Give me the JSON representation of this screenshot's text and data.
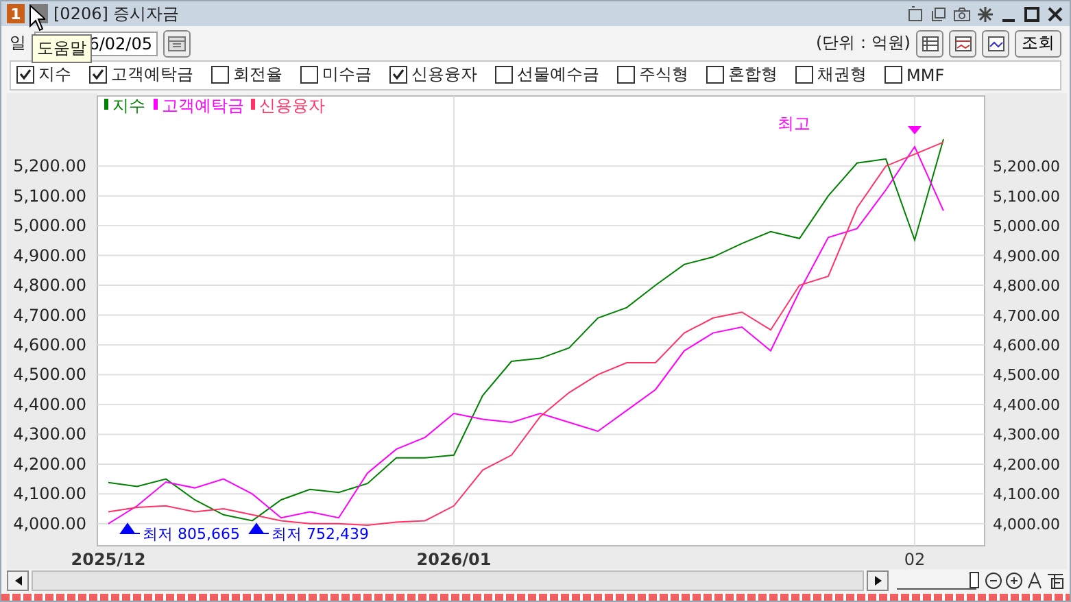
{
  "window": {
    "badge": "1",
    "title": "[0206] 증시자금"
  },
  "tooltip": {
    "text": "도움말"
  },
  "toolbar": {
    "date_label": "일",
    "date_value": "6/02/05",
    "unit": "(단위 : 억원)",
    "query_button": "조회"
  },
  "checkboxes": [
    {
      "label": "지수",
      "checked": true
    },
    {
      "label": "고객예탁금",
      "checked": true
    },
    {
      "label": "회전율",
      "checked": false
    },
    {
      "label": "미수금",
      "checked": false
    },
    {
      "label": "신용융자",
      "checked": true
    },
    {
      "label": "선물예수금",
      "checked": false
    },
    {
      "label": "주식형",
      "checked": false
    },
    {
      "label": "혼합형",
      "checked": false
    },
    {
      "label": "채권형",
      "checked": false
    },
    {
      "label": "MMF",
      "checked": false
    }
  ],
  "chart": {
    "markers": [
      {
        "kind": "low",
        "color": "#0000ff"
      },
      {
        "kind": "low",
        "color": "#0000ff"
      },
      {
        "kind": "high",
        "color": "#ff00ff"
      }
    ],
    "chart_data": {
      "type": "line",
      "grid": true,
      "legend": true,
      "categories": [
        "2025/12",
        null,
        null,
        null,
        null,
        null,
        null,
        null,
        null,
        null,
        null,
        null,
        "2026/01",
        null,
        null,
        null,
        null,
        null,
        null,
        null,
        null,
        null,
        null,
        null,
        null,
        null,
        null,
        null,
        "02",
        null
      ],
      "series": [
        {
          "name": "지수",
          "color": "#008000",
          "values": [
            4138,
            4125,
            4150,
            4080,
            4030,
            4010,
            4080,
            4115,
            4105,
            4135,
            4221,
            4221,
            4230,
            4430,
            4545,
            4555,
            4590,
            4690,
            4725,
            4800,
            4870,
            4895,
            4940,
            4980,
            4957,
            5100,
            5210,
            5224,
            4952,
            5290
          ]
        },
        {
          "name": "고객예탁금",
          "color": "#ff00ff",
          "values": [
            4000,
            4060,
            4140,
            4120,
            4150,
            4100,
            4020,
            4040,
            4020,
            4170,
            4250,
            4290,
            4370,
            4350,
            4340,
            4370,
            4340,
            4310,
            4380,
            4450,
            4580,
            4640,
            4660,
            4580,
            4780,
            4960,
            4990,
            5120,
            5265,
            5050
          ]
        },
        {
          "name": "신용융자",
          "color": "#ff3366",
          "values": [
            4040,
            4055,
            4060,
            4040,
            4050,
            4030,
            4010,
            4000,
            4000,
            3995,
            4005,
            4010,
            4060,
            4180,
            4230,
            4360,
            4440,
            4500,
            4540,
            4540,
            4640,
            4690,
            4710,
            4650,
            4800,
            4830,
            5060,
            5200,
            5240,
            5280
          ]
        }
      ],
      "ylim": [
        3926,
        5435
      ],
      "yticks": [
        {
          "value": 4000,
          "label": "4,000.00"
        },
        {
          "value": 4100,
          "label": "4,100.00"
        },
        {
          "value": 4200,
          "label": "4,200.00"
        },
        {
          "value": 4300,
          "label": "4,300.00"
        },
        {
          "value": 4400,
          "label": "4,400.00"
        },
        {
          "value": 4500,
          "label": "4,500.00"
        },
        {
          "value": 4600,
          "label": "4,600.00"
        },
        {
          "value": 4700,
          "label": "4,700.00"
        },
        {
          "value": 4800,
          "label": "4,800.00"
        },
        {
          "value": 4900,
          "label": "4,900.00"
        },
        {
          "value": 5000,
          "label": "5,000.00"
        },
        {
          "value": 5100,
          "label": "5,100.00"
        },
        {
          "value": 5200,
          "label": "5,200.00"
        }
      ],
      "annotations": [
        "최저 805,665",
        "최저 752,439",
        "최고"
      ]
    }
  },
  "zoom_slider": {
    "level": 0.97
  }
}
